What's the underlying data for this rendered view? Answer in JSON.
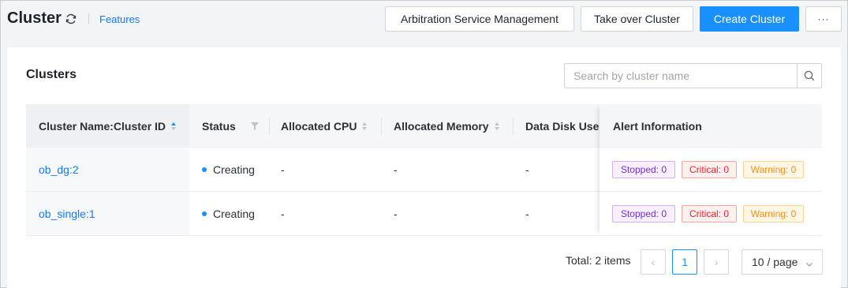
{
  "header": {
    "title": "Cluster",
    "features_link": "Features",
    "buttons": {
      "arbitration": "Arbitration Service Management",
      "take_over": "Take over Cluster",
      "create": "Create Cluster",
      "more": "···"
    },
    "icons": {
      "refresh": "refresh-icon",
      "more": "more-icon"
    }
  },
  "panel": {
    "title": "Clusters",
    "search": {
      "placeholder": "Search by cluster name",
      "value": "",
      "icon": "search-icon"
    }
  },
  "table": {
    "columns": [
      {
        "label": "Cluster Name:Cluster ID",
        "icon": "sort-icon"
      },
      {
        "label": "Status",
        "icon": "filter-icon"
      },
      {
        "label": "Allocated CPU",
        "icon": "sort-icon"
      },
      {
        "label": "Allocated Memory",
        "icon": "sort-icon"
      },
      {
        "label": "Data Disk Used",
        "icon": ""
      },
      {
        "label": "Alert Information",
        "icon": ""
      }
    ],
    "rows": [
      {
        "name": "ob_dg:2",
        "status": "Creating",
        "cpu": "-",
        "memory": "-",
        "disk": "-",
        "alerts": {
          "stopped": "Stopped: 0",
          "critical": "Critical: 0",
          "warning": "Warning: 0"
        }
      },
      {
        "name": "ob_single:1",
        "status": "Creating",
        "cpu": "-",
        "memory": "-",
        "disk": "-",
        "alerts": {
          "stopped": "Stopped: 0",
          "critical": "Critical: 0",
          "warning": "Warning: 0"
        }
      }
    ]
  },
  "pagination": {
    "total": "Total: 2 items",
    "current_page": "1",
    "page_size": "10 / page",
    "prev": "‹",
    "next": "›"
  },
  "colors": {
    "primary": "#1890ff",
    "link": "#1677ff",
    "stopped": "#722ed1",
    "critical": "#f5222d",
    "warning": "#fa8c16"
  }
}
